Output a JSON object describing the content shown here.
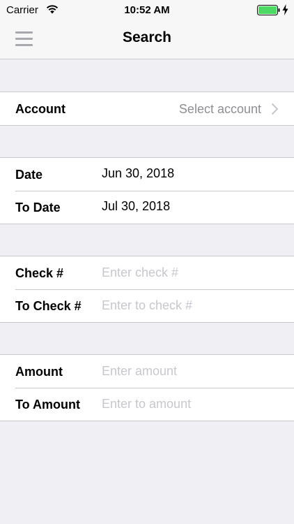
{
  "status_bar": {
    "carrier": "Carrier",
    "time": "10:52 AM",
    "battery_color": "#4cd964"
  },
  "nav": {
    "title": "Search"
  },
  "account": {
    "label": "Account",
    "value": "Select account"
  },
  "dates": {
    "date_label": "Date",
    "date_value": "Jun 30, 2018",
    "to_date_label": "To Date",
    "to_date_value": "Jul 30, 2018"
  },
  "check": {
    "check_label": "Check #",
    "check_placeholder": "Enter check #",
    "to_check_label": "To Check #",
    "to_check_placeholder": "Enter to check #"
  },
  "amount": {
    "amount_label": "Amount",
    "amount_placeholder": "Enter amount",
    "to_amount_label": "To Amount",
    "to_amount_placeholder": "Enter to amount"
  }
}
